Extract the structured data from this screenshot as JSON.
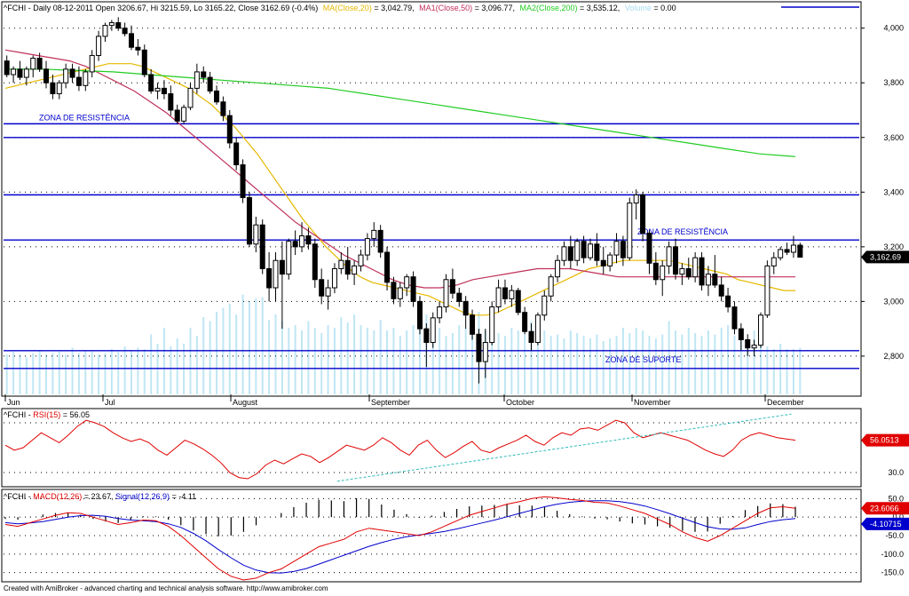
{
  "chart_data": [
    {
      "type": "candlestick",
      "symbol": "^FCHI",
      "header": {
        "prefix": "^FCHI - Daily 08-12-2011 Open 3206.67, Hi 3215.59, Lo 3165.22, Close 3162.69 (-0.4%)",
        "ma20_label": "MA(Close,20)",
        "ma20_value": " = 3,042.79,",
        "ma50_label": "MA1(Close,50)",
        "ma50_value": " = 3,096.77,",
        "ma200_label": "MA2(Close,200)",
        "ma200_value": " = 3,535.12,",
        "volume_label": "Volume",
        "volume_value": " = 0.00"
      },
      "months": [
        "Jun",
        "Jul",
        "August",
        "September",
        "October",
        "November",
        "December"
      ],
      "y_ticks": [
        "4,000",
        "3,800",
        "3,600",
        "3,400",
        "3,200",
        "3,000",
        "2,800"
      ],
      "ylim": [
        2660,
        4090
      ],
      "last_price_label": "3,162.69",
      "hlines": [
        {
          "value": 3650,
          "label": "ZONA DE RESISTÊNCIA"
        },
        {
          "value": 3600,
          "label": ""
        },
        {
          "value": 3390,
          "label": ""
        },
        {
          "value": 3225,
          "label": "ZONA DE RESISTÊNCIA"
        },
        {
          "value": 2820,
          "label": "ZONA DE SUPORTE"
        },
        {
          "value": 2755,
          "label": ""
        }
      ],
      "candles": [
        [
          3880,
          3900,
          3820,
          3830
        ],
        [
          3830,
          3860,
          3800,
          3850
        ],
        [
          3850,
          3880,
          3810,
          3820
        ],
        [
          3820,
          3860,
          3790,
          3850
        ],
        [
          3850,
          3900,
          3820,
          3890
        ],
        [
          3890,
          3910,
          3840,
          3850
        ],
        [
          3850,
          3880,
          3780,
          3800
        ],
        [
          3800,
          3830,
          3740,
          3760
        ],
        [
          3760,
          3810,
          3740,
          3800
        ],
        [
          3800,
          3870,
          3780,
          3850
        ],
        [
          3850,
          3870,
          3800,
          3820
        ],
        [
          3820,
          3860,
          3770,
          3790
        ],
        [
          3790,
          3850,
          3770,
          3840
        ],
        [
          3840,
          3920,
          3820,
          3900
        ],
        [
          3900,
          3990,
          3880,
          3970
        ],
        [
          3970,
          4020,
          3950,
          4010
        ],
        [
          4010,
          4030,
          3990,
          4020
        ],
        [
          4020,
          4040,
          3990,
          4000
        ],
        [
          4000,
          4020,
          3970,
          3980
        ],
        [
          3980,
          4010,
          3920,
          3930
        ],
        [
          3930,
          3960,
          3900,
          3920
        ],
        [
          3920,
          3940,
          3820,
          3830
        ],
        [
          3830,
          3850,
          3760,
          3770
        ],
        [
          3770,
          3800,
          3740,
          3780
        ],
        [
          3780,
          3810,
          3740,
          3760
        ],
        [
          3760,
          3790,
          3680,
          3700
        ],
        [
          3700,
          3720,
          3650,
          3660
        ],
        [
          3660,
          3720,
          3650,
          3710
        ],
        [
          3710,
          3800,
          3700,
          3780
        ],
        [
          3780,
          3870,
          3760,
          3840
        ],
        [
          3840,
          3860,
          3800,
          3820
        ],
        [
          3820,
          3840,
          3760,
          3770
        ],
        [
          3770,
          3790,
          3720,
          3730
        ],
        [
          3730,
          3750,
          3660,
          3680
        ],
        [
          3680,
          3700,
          3560,
          3580
        ],
        [
          3580,
          3600,
          3480,
          3500
        ],
        [
          3500,
          3520,
          3360,
          3380
        ],
        [
          3380,
          3400,
          3200,
          3210
        ],
        [
          3210,
          3310,
          3180,
          3280
        ],
        [
          3280,
          3300,
          3100,
          3120
        ],
        [
          3120,
          3180,
          3000,
          3050
        ],
        [
          3050,
          3180,
          3000,
          3150
        ],
        [
          3150,
          3220,
          2900,
          3100
        ],
        [
          3100,
          3230,
          3080,
          3220
        ],
        [
          3220,
          3260,
          3170,
          3200
        ],
        [
          3200,
          3290,
          3180,
          3240
        ],
        [
          3240,
          3270,
          3190,
          3210
        ],
        [
          3210,
          3230,
          3050,
          3080
        ],
        [
          3080,
          3120,
          2990,
          3020
        ],
        [
          3020,
          3080,
          2970,
          3050
        ],
        [
          3050,
          3140,
          3030,
          3120
        ],
        [
          3120,
          3180,
          3100,
          3150
        ],
        [
          3150,
          3200,
          3080,
          3100
        ],
        [
          3100,
          3150,
          3060,
          3130
        ],
        [
          3130,
          3190,
          3110,
          3170
        ],
        [
          3170,
          3250,
          3150,
          3230
        ],
        [
          3230,
          3290,
          3200,
          3260
        ],
        [
          3260,
          3280,
          3160,
          3180
        ],
        [
          3180,
          3200,
          3040,
          3070
        ],
        [
          3070,
          3090,
          2990,
          3010
        ],
        [
          3010,
          3070,
          2980,
          3050
        ],
        [
          3050,
          3100,
          3020,
          3090
        ],
        [
          3090,
          3110,
          2980,
          3000
        ],
        [
          3000,
          3020,
          2880,
          2900
        ],
        [
          2900,
          2920,
          2760,
          2850
        ],
        [
          2850,
          2960,
          2830,
          2940
        ],
        [
          2940,
          3000,
          2920,
          2980
        ],
        [
          2980,
          3100,
          2960,
          3080
        ],
        [
          3080,
          3120,
          3010,
          3030
        ],
        [
          3030,
          3050,
          2980,
          3000
        ],
        [
          3000,
          3020,
          2900,
          2950
        ],
        [
          2950,
          2970,
          2860,
          2880
        ],
        [
          2880,
          2900,
          2700,
          2780
        ],
        [
          2780,
          2900,
          2720,
          2850
        ],
        [
          2850,
          3000,
          2840,
          2980
        ],
        [
          2980,
          3080,
          2960,
          3050
        ],
        [
          3050,
          3080,
          2990,
          3010
        ],
        [
          3010,
          3060,
          2980,
          3040
        ],
        [
          3040,
          3050,
          2950,
          2960
        ],
        [
          2960,
          2980,
          2880,
          2890
        ],
        [
          2890,
          2920,
          2820,
          2850
        ],
        [
          2850,
          2960,
          2840,
          2950
        ],
        [
          2950,
          3040,
          2930,
          3020
        ],
        [
          3020,
          3100,
          3000,
          3090
        ],
        [
          3090,
          3170,
          3070,
          3150
        ],
        [
          3150,
          3220,
          3130,
          3200
        ],
        [
          3200,
          3240,
          3120,
          3150
        ],
        [
          3150,
          3230,
          3130,
          3220
        ],
        [
          3220,
          3240,
          3140,
          3160
        ],
        [
          3160,
          3230,
          3150,
          3210
        ],
        [
          3210,
          3250,
          3130,
          3150
        ],
        [
          3150,
          3200,
          3100,
          3130
        ],
        [
          3130,
          3180,
          3110,
          3170
        ],
        [
          3170,
          3250,
          3140,
          3220
        ],
        [
          3220,
          3240,
          3130,
          3160
        ],
        [
          3160,
          3380,
          3150,
          3360
        ],
        [
          3360,
          3410,
          3300,
          3390
        ],
        [
          3390,
          3400,
          3220,
          3250
        ],
        [
          3250,
          3260,
          3100,
          3140
        ],
        [
          3140,
          3180,
          3060,
          3080
        ],
        [
          3080,
          3150,
          3020,
          3130
        ],
        [
          3130,
          3220,
          3100,
          3200
        ],
        [
          3200,
          3230,
          3080,
          3100
        ],
        [
          3100,
          3140,
          3060,
          3120
        ],
        [
          3120,
          3160,
          3080,
          3090
        ],
        [
          3090,
          3180,
          3070,
          3160
        ],
        [
          3160,
          3180,
          3040,
          3060
        ],
        [
          3060,
          3130,
          3020,
          3100
        ],
        [
          3100,
          3170,
          3050,
          3060
        ],
        [
          3060,
          3090,
          3000,
          3020
        ],
        [
          3020,
          3050,
          2960,
          2980
        ],
        [
          2980,
          3000,
          2880,
          2900
        ],
        [
          2900,
          2920,
          2820,
          2860
        ],
        [
          2860,
          2880,
          2800,
          2830
        ],
        [
          2830,
          2860,
          2800,
          2840
        ],
        [
          2840,
          2960,
          2830,
          2950
        ],
        [
          2950,
          3150,
          2940,
          3130
        ],
        [
          3130,
          3180,
          3100,
          3160
        ],
        [
          3160,
          3200,
          3150,
          3190
        ],
        [
          3190,
          3215,
          3170,
          3180
        ],
        [
          3180,
          3240,
          3160,
          3206
        ],
        [
          3206,
          3215,
          3165,
          3162
        ]
      ],
      "ma20": [
        3780,
        3790,
        3800,
        3810,
        3820,
        3830,
        3840,
        3850,
        3860,
        3870,
        3870,
        3870,
        3860,
        3840,
        3820,
        3800,
        3780,
        3750,
        3720,
        3680,
        3640,
        3590,
        3540,
        3480,
        3420,
        3360,
        3300,
        3250,
        3200,
        3160,
        3120,
        3090,
        3070,
        3060,
        3050,
        3040,
        3030,
        3020,
        3000,
        2980,
        2960,
        2950,
        2950,
        2960,
        2980,
        3000,
        3020,
        3040,
        3060,
        3080,
        3100,
        3120,
        3130,
        3140,
        3150,
        3150,
        3150,
        3150,
        3150,
        3140,
        3130,
        3120,
        3110,
        3100,
        3080,
        3070,
        3060,
        3050,
        3040,
        3040
      ],
      "ma50": [
        3920,
        3910,
        3900,
        3890,
        3880,
        3860,
        3830,
        3800,
        3770,
        3730,
        3690,
        3640,
        3590,
        3540,
        3490,
        3440,
        3390,
        3340,
        3290,
        3250,
        3210,
        3170,
        3140,
        3110,
        3080,
        3060,
        3050,
        3050,
        3060,
        3080,
        3090,
        3100,
        3110,
        3120,
        3120,
        3120,
        3110,
        3100,
        3090,
        3090,
        3090,
        3090,
        3090,
        3090,
        3090,
        3090,
        3090,
        3090,
        3090,
        3090
      ],
      "ma200": [
        3850,
        3850,
        3845,
        3840,
        3830,
        3820,
        3810,
        3800,
        3790,
        3780,
        3760,
        3740,
        3720,
        3700,
        3680,
        3660,
        3640,
        3620,
        3600,
        3580,
        3560,
        3540,
        3530
      ],
      "volume": [
        0.3,
        0.32,
        0.3,
        0.28,
        0.31,
        0.33,
        0.3,
        0.31,
        0.32,
        0.3,
        0.35,
        0.31,
        0.33,
        0.32,
        0.3,
        0.31,
        0.34,
        0.32,
        0.36,
        0.33,
        0.35,
        0.34,
        0.45,
        0.38,
        0.5,
        0.36,
        0.42,
        0.38,
        0.5,
        0.44,
        0.58,
        0.55,
        0.62,
        0.65,
        0.68,
        0.6,
        0.75,
        0.7,
        0.72,
        0.73,
        0.56,
        0.6,
        0.55,
        0.5,
        0.52,
        0.48,
        0.55,
        0.5,
        0.46,
        0.52,
        0.5,
        0.58,
        0.54,
        0.6,
        0.52,
        0.5,
        0.48,
        0.56,
        0.48,
        0.5,
        0.44,
        0.48,
        0.52,
        0.5,
        0.6,
        0.48,
        0.5,
        0.44,
        0.46,
        0.52,
        0.5,
        0.55,
        0.62,
        0.48,
        0.5,
        0.46,
        0.44,
        0.5,
        0.48,
        0.45,
        0.55,
        0.46,
        0.48,
        0.44,
        0.45,
        0.42,
        0.48,
        0.46,
        0.44,
        0.42,
        0.45,
        0.4,
        0.42,
        0.44,
        0.5,
        0.46,
        0.5,
        0.48,
        0.44,
        0.42,
        0.45,
        0.55,
        0.48,
        0.45,
        0.5,
        0.46,
        0.44,
        0.48,
        0.45,
        0.5,
        0.52,
        0.44,
        0.46,
        0.4,
        0.48,
        0.44,
        0.36,
        0.34,
        0.38,
        0.34,
        0.34,
        0.35
      ]
    },
    {
      "type": "line",
      "label_prefix": "^FCHI - ",
      "name": "RSI(15)",
      "value_text": " = 56.05",
      "y_ticks": [
        "30.0"
      ],
      "ylim": [
        20,
        80
      ],
      "last_label": "56.0513",
      "values": [
        52,
        48,
        50,
        56,
        62,
        58,
        54,
        60,
        67,
        72,
        70,
        67,
        62,
        58,
        55,
        57,
        54,
        48,
        44,
        50,
        56,
        53,
        49,
        44,
        38,
        30,
        26,
        25,
        29,
        36,
        40,
        37,
        41,
        45,
        43,
        38,
        42,
        47,
        52,
        50,
        48,
        52,
        58,
        54,
        48,
        44,
        52,
        56,
        48,
        42,
        46,
        51,
        55,
        48,
        46,
        50,
        53,
        56,
        60,
        55,
        52,
        58,
        62,
        60,
        65,
        66,
        64,
        68,
        72,
        70,
        62,
        58,
        60,
        62,
        60,
        58,
        56,
        52,
        48,
        45,
        43,
        48,
        56,
        60,
        62,
        60,
        58,
        57,
        56
      ],
      "trendline": [
        [
          0.42,
          0.05
        ],
        [
          0.995,
          0.95
        ]
      ]
    },
    {
      "type": "line",
      "label_prefix": "^FCHI - ",
      "series_names": [
        "MACD(12,26)",
        "Signal(12,26,9)"
      ],
      "macd_text": " = 23.67, ",
      "signal_text": " = -4.11",
      "y_ticks": [
        "50.0",
        "0.0",
        "-50.0",
        "-100.0",
        "-150.0"
      ],
      "ylim": [
        -170,
        70
      ],
      "last_macd_label": "23.6066",
      "last_signal_label": "-4.10715",
      "macd": [
        -20,
        -25,
        -15,
        -5,
        5,
        12,
        10,
        0,
        -10,
        -20,
        -15,
        -8,
        -10,
        -25,
        -50,
        -80,
        -110,
        -140,
        -160,
        -170,
        -165,
        -150,
        -140,
        -120,
        -100,
        -80,
        -70,
        -60,
        -40,
        -30,
        -35,
        -40,
        -45,
        -50,
        -40,
        -25,
        -10,
        5,
        15,
        25,
        35,
        42,
        50,
        55,
        52,
        48,
        45,
        40,
        38,
        30,
        20,
        10,
        -5,
        -20,
        -40,
        -55,
        -65,
        -50,
        -30,
        -10,
        10,
        25,
        28,
        24
      ],
      "signal": [
        -15,
        -18,
        -16,
        -12,
        -6,
        0,
        4,
        5,
        2,
        -4,
        -8,
        -10,
        -12,
        -18,
        -28,
        -44,
        -64,
        -88,
        -110,
        -130,
        -143,
        -150,
        -151,
        -147,
        -139,
        -127,
        -115,
        -103,
        -91,
        -79,
        -69,
        -60,
        -53,
        -48,
        -44,
        -39,
        -32,
        -24,
        -16,
        -8,
        1,
        10,
        19,
        28,
        35,
        40,
        43,
        44,
        44,
        42,
        37,
        30,
        20,
        9,
        -3,
        -15,
        -26,
        -32,
        -33,
        -29,
        -20,
        -12,
        -7,
        -4
      ]
    }
  ],
  "x_months_pos": [
    "Jun",
    "Jul",
    "August",
    "September",
    "October",
    "November",
    "December"
  ],
  "footer": "Created with AmiBroker - advanced charting and technical analysis software. http://www.amibroker.com"
}
